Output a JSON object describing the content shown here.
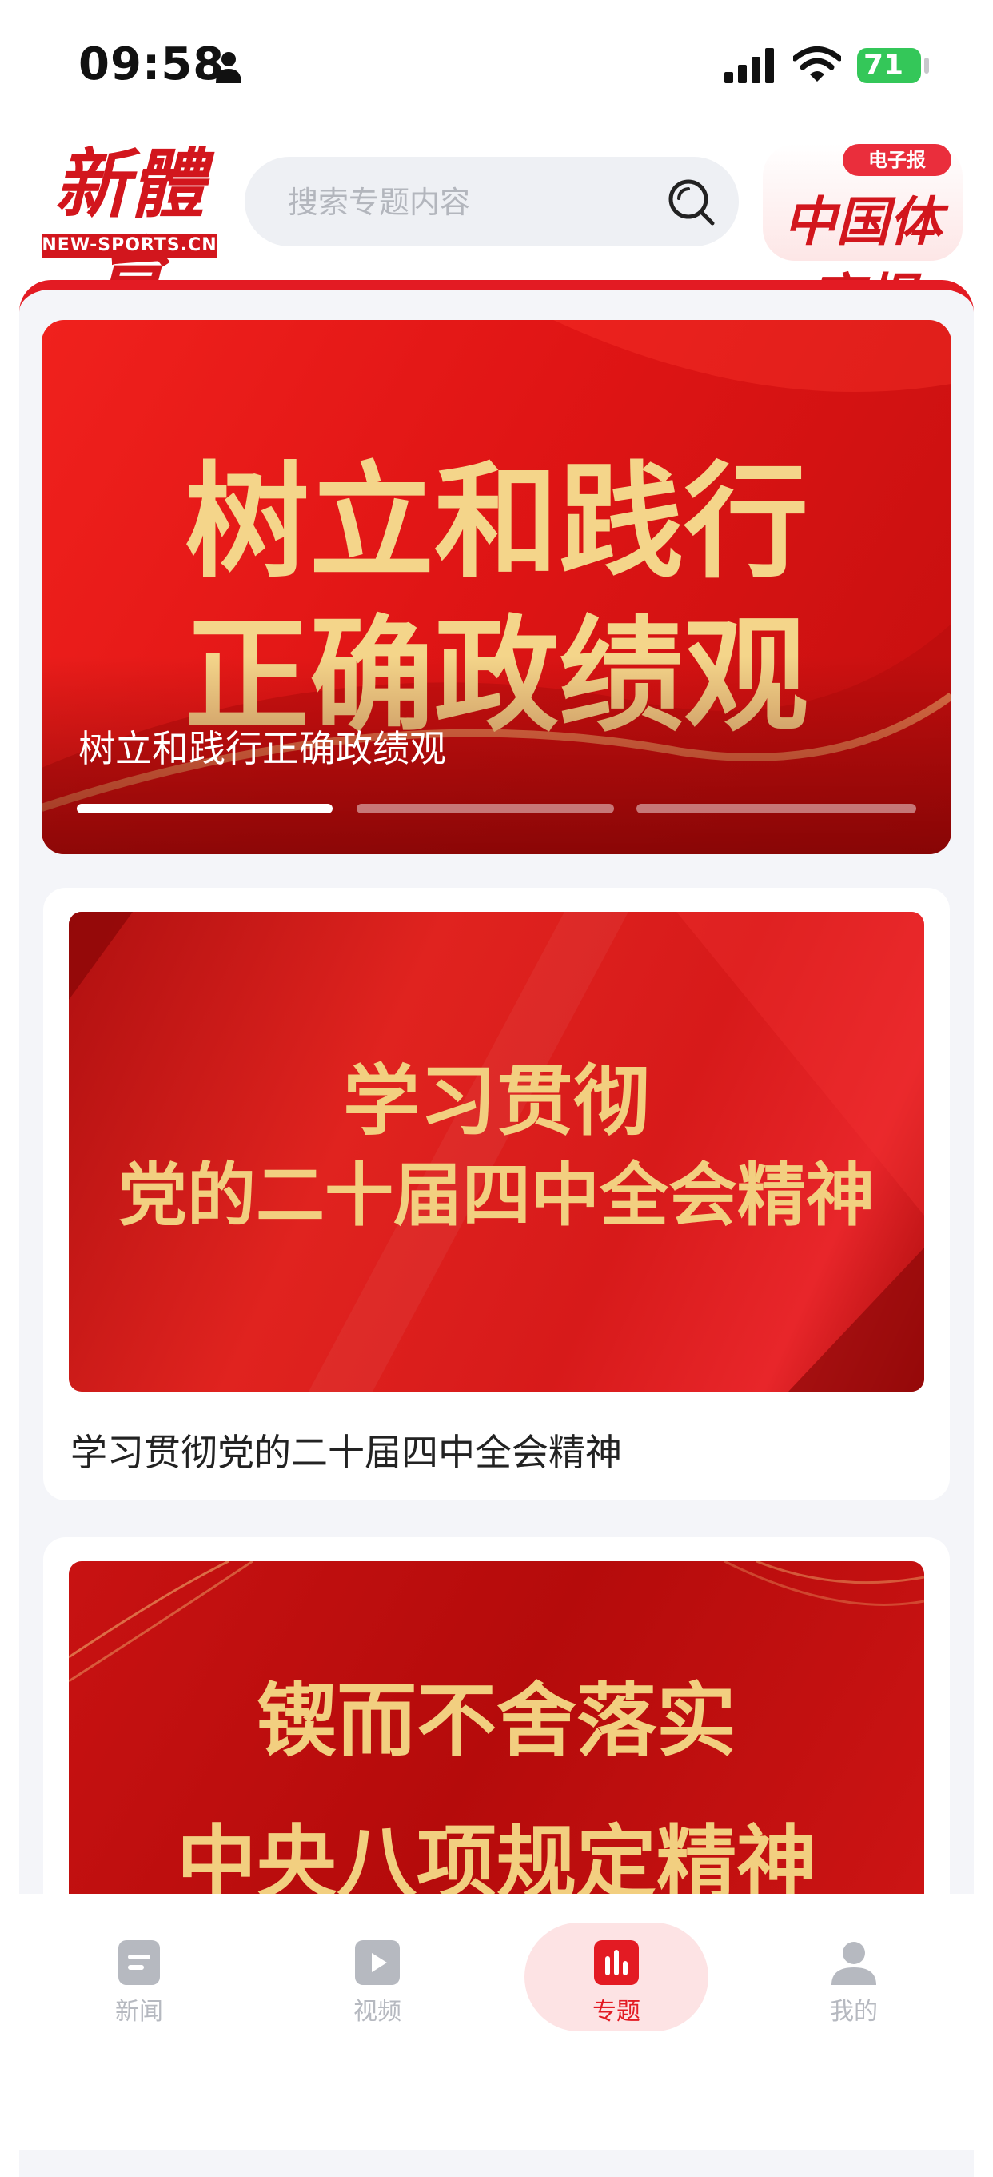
{
  "status_bar": {
    "time": "09:58",
    "battery": "71"
  },
  "header": {
    "logo_text": "新體育",
    "logo_sub": "NEW-SPORTS.CN",
    "search_placeholder": "搜索专题内容",
    "paper_name": "中国体育报",
    "paper_badge": "电子报"
  },
  "banner": {
    "image_title_line1": "树立和践行",
    "image_title_line2": "正确政绩观",
    "caption": "树立和践行正确政绩观",
    "page_count": 3,
    "active_index": 0
  },
  "cards": [
    {
      "image_title_line1": "学习贯彻",
      "image_title_line2": "党的二十届四中全会精神",
      "caption": "学习贯彻党的二十届四中全会精神"
    },
    {
      "image_title_line1": "锲而不舍落实",
      "image_title_line2": "中央八项规定精神"
    }
  ],
  "tabs": [
    {
      "label": "新闻",
      "icon": "news-icon",
      "active": false
    },
    {
      "label": "视频",
      "icon": "video-icon",
      "active": false
    },
    {
      "label": "专题",
      "icon": "topics-icon",
      "active": true
    },
    {
      "label": "我的",
      "icon": "profile-icon",
      "active": false
    }
  ],
  "colors": {
    "accent": "#e31b23",
    "gold_text": "#f4d58a",
    "inactive_tab": "#b6b9c0",
    "panel_bg": "#f4f5f9"
  }
}
